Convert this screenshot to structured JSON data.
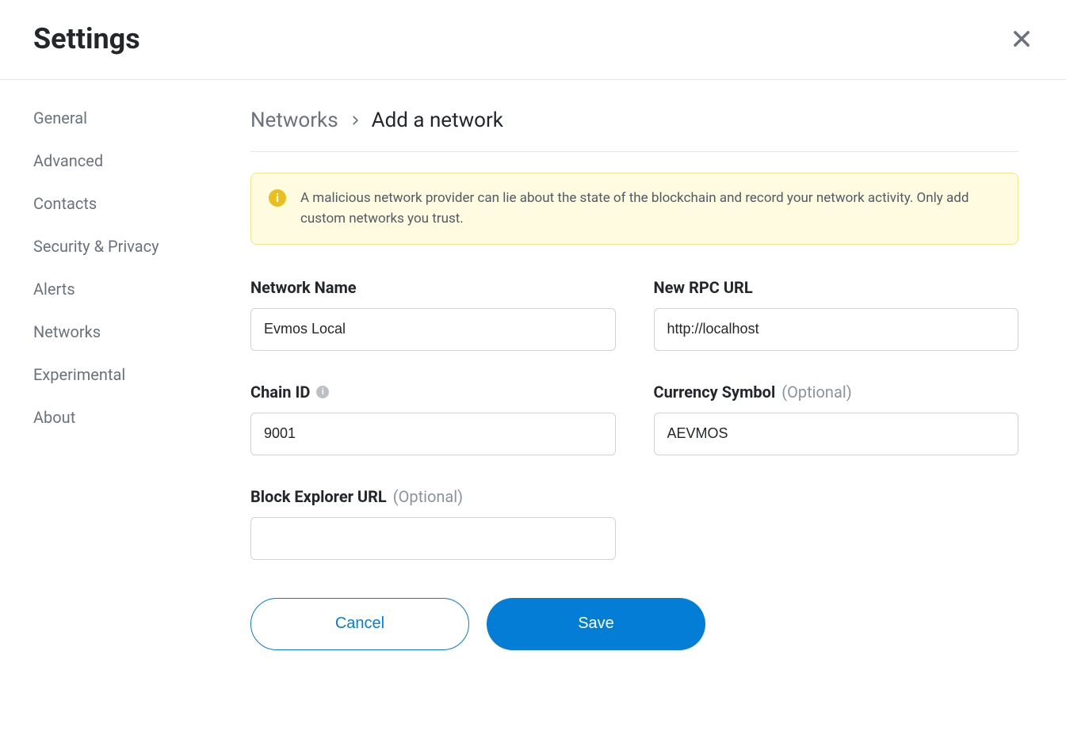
{
  "header": {
    "title": "Settings"
  },
  "sidebar": {
    "items": [
      {
        "label": "General"
      },
      {
        "label": "Advanced"
      },
      {
        "label": "Contacts"
      },
      {
        "label": "Security & Privacy"
      },
      {
        "label": "Alerts"
      },
      {
        "label": "Networks"
      },
      {
        "label": "Experimental"
      },
      {
        "label": "About"
      }
    ]
  },
  "breadcrumb": {
    "parent": "Networks",
    "current": "Add a network"
  },
  "warning": {
    "text": "A malicious network provider can lie about the state of the blockchain and record your network activity. Only add custom networks you trust."
  },
  "form": {
    "network_name": {
      "label": "Network Name",
      "value": "Evmos Local"
    },
    "rpc_url": {
      "label": "New RPC URL",
      "value": "http://localhost"
    },
    "chain_id": {
      "label": "Chain ID",
      "value": "9001"
    },
    "currency_symbol": {
      "label": "Currency Symbol",
      "optional": "(Optional)",
      "value": "AEVMOS"
    },
    "block_explorer": {
      "label": "Block Explorer URL",
      "optional": "(Optional)",
      "value": ""
    }
  },
  "buttons": {
    "cancel": "Cancel",
    "save": "Save"
  }
}
